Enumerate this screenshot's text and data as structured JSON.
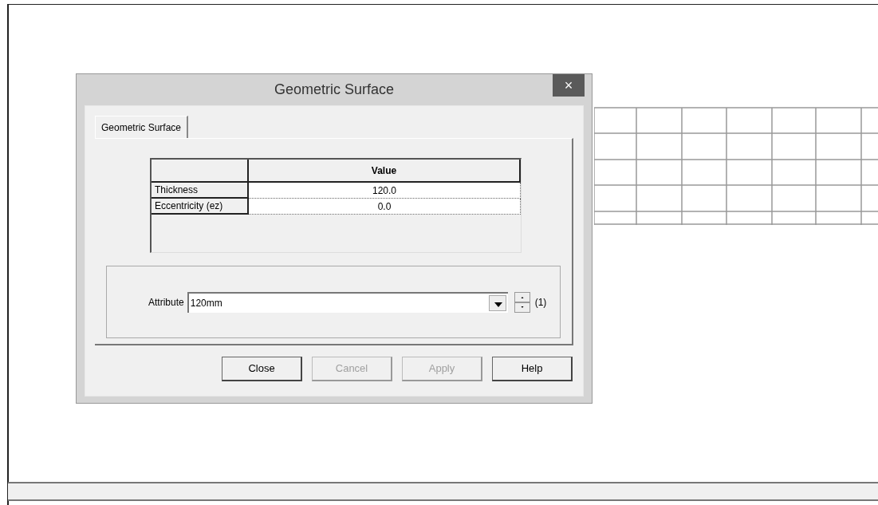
{
  "dialog": {
    "title": "Geometric Surface",
    "close_glyph": "×"
  },
  "tabs": [
    {
      "label": "Geometric Surface",
      "selected": true
    }
  ],
  "table": {
    "columns": [
      "Value"
    ],
    "rows": [
      {
        "name": "Thickness",
        "value": "120.0"
      },
      {
        "name": "Eccentricity (ez)",
        "value": "0.0"
      }
    ]
  },
  "attribute": {
    "label": "Attribute",
    "value": "120mm",
    "counter": "(1)"
  },
  "buttons": [
    {
      "label": "Close",
      "disabled": false
    },
    {
      "label": "Cancel",
      "disabled": true
    },
    {
      "label": "Apply",
      "disabled": true
    },
    {
      "label": "Help",
      "disabled": false
    }
  ]
}
